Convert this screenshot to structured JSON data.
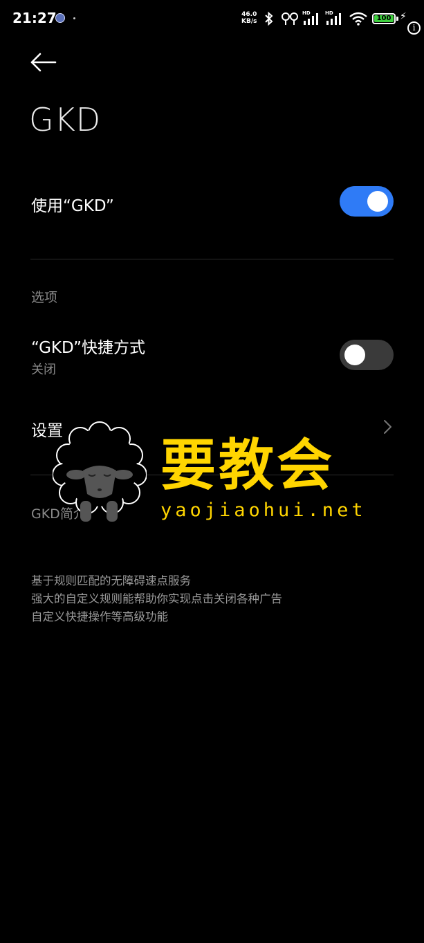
{
  "status_bar": {
    "time": "21:27",
    "net_speed_value": "46.0",
    "net_speed_unit": "KB/s",
    "bluetooth_icon": "bluetooth-icon",
    "earbuds_icon": "earbuds-icon",
    "signal_label": "HD",
    "battery_level": "100",
    "charging_icon": "lightning-icon",
    "info_icon": "info-icon",
    "info_glyph": "i"
  },
  "header": {
    "back_icon": "arrow-left-icon",
    "title": "GKD"
  },
  "main_switch": {
    "label": "使用“GKD”",
    "enabled": true
  },
  "options": {
    "section_label": "选项",
    "shortcut": {
      "title": "“GKD”快捷方式",
      "subtitle": "关闭",
      "enabled": false
    },
    "settings": {
      "title": "设置"
    }
  },
  "intro": {
    "section_label": "GKD简介",
    "lines": [
      "基于规则匹配的无障碍速点服务",
      "强大的自定义规则能帮助你实现点击关闭各种广告",
      "自定义快捷操作等高级功能"
    ]
  },
  "watermark": {
    "text": "要教会",
    "url": "yaojiaohui.net"
  },
  "colors": {
    "background": "#000000",
    "accent": "#2f7bf6",
    "toggle_off": "#3a3a3a",
    "watermark": "#ffd500",
    "battery": "#3ecf3e"
  }
}
